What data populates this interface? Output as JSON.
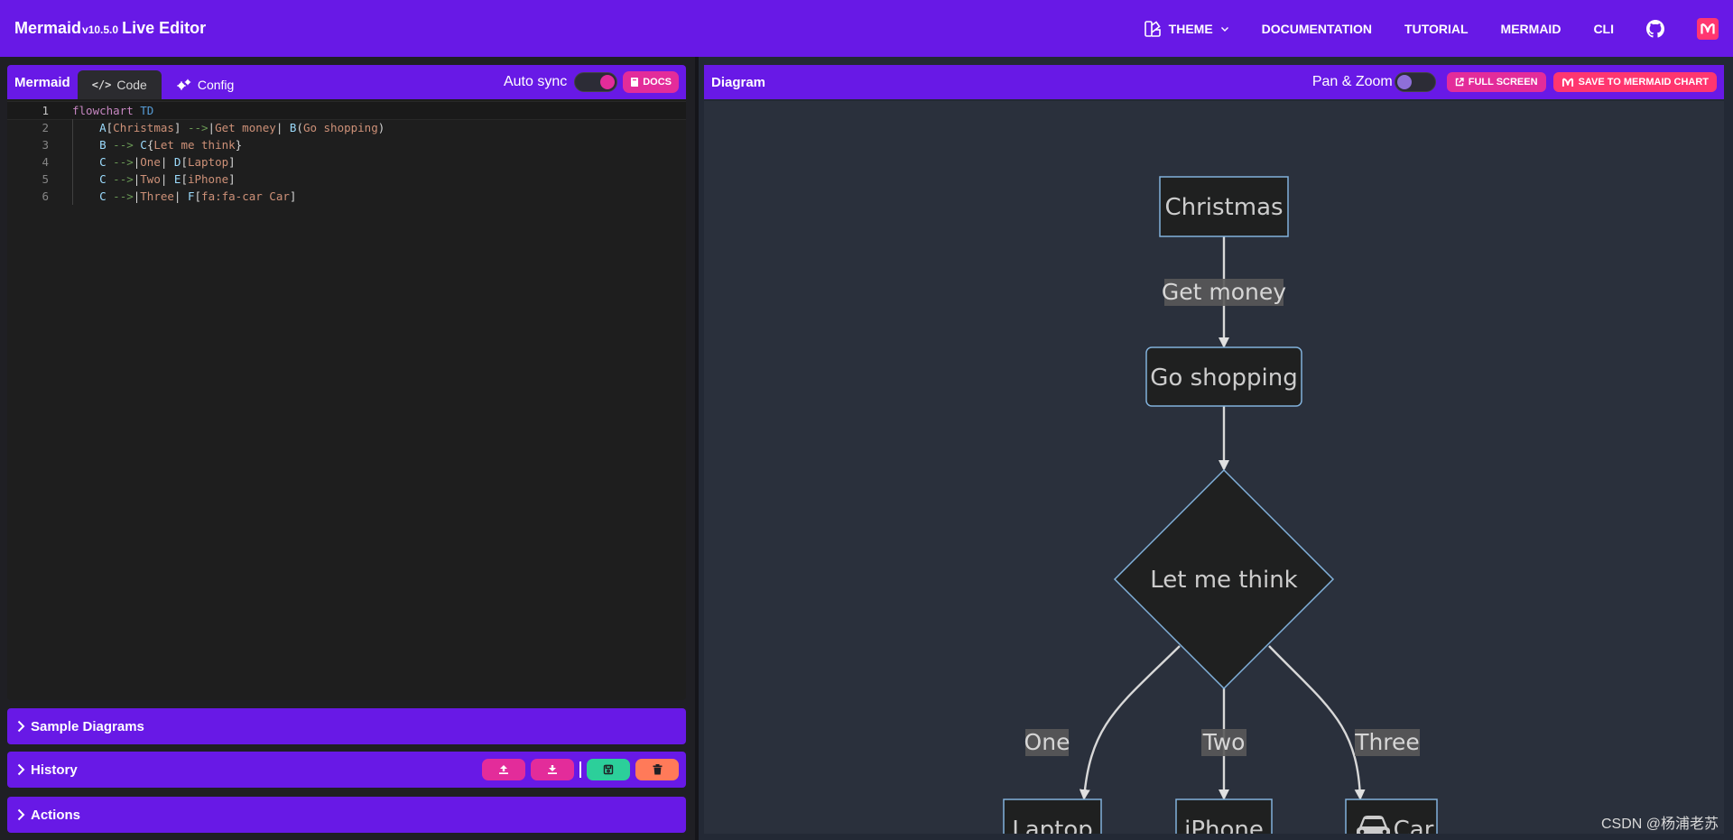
{
  "app": {
    "brand_name": "Mermaid",
    "version": "v10.5.0",
    "brand_suffix": "Live Editor"
  },
  "nav": {
    "theme": "THEME",
    "documentation": "DOCUMENTATION",
    "tutorial": "TUTORIAL",
    "mermaid": "MERMAID",
    "cli": "CLI"
  },
  "editor": {
    "title": "Mermaid",
    "tabs": [
      "Code",
      "Config"
    ],
    "active_tab": "Code",
    "auto_sync_label": "Auto sync",
    "auto_sync_on": true,
    "docs_label": "DOCS",
    "current_line": 1,
    "lines": [
      "flowchart TD",
      "    A[Christmas] -->|Get money| B(Go shopping)",
      "    B --> C{Let me think}",
      "    C -->|One| D[Laptop]",
      "    C -->|Two| E[iPhone]",
      "    C -->|Three| F[fa:fa-car Car]"
    ]
  },
  "panels": {
    "sample_diagrams": "Sample Diagrams",
    "history": "History",
    "actions": "Actions"
  },
  "diagram": {
    "title": "Diagram",
    "pan_zoom_label": "Pan & Zoom",
    "pan_zoom_on": false,
    "full_screen": "FULL SCREEN",
    "save_chart": "SAVE TO MERMAID CHART",
    "nodes": {
      "A": "Christmas",
      "B": "Go shopping",
      "C": "Let me think",
      "D": "Laptop",
      "E": "iPhone",
      "F": "Car"
    },
    "edge_labels": {
      "AB": "Get money",
      "CD": "One",
      "CE": "Two",
      "CF": "Three"
    }
  },
  "watermark": "CSDN @杨浦老苏",
  "colors": {
    "accent": "#6819e6",
    "pink": "#e32c9a",
    "red": "#ff3670",
    "green": "#2ccf9a",
    "orange": "#ff7a59"
  }
}
